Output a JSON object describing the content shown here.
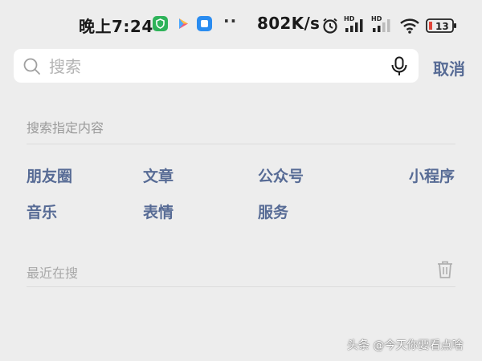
{
  "status_bar": {
    "time": "晚上7:24",
    "more_dots": "··",
    "network_speed": "802K/s",
    "signal_labels": [
      "HD",
      "HD"
    ],
    "battery": "13",
    "icons": [
      "shield-app-icon",
      "play-app-icon",
      "blue-app-icon",
      "alarm-icon",
      "signal-icon",
      "wifi-icon",
      "battery-icon"
    ]
  },
  "search": {
    "placeholder": "搜索",
    "value": "",
    "cancel_label": "取消"
  },
  "specified": {
    "title": "搜索指定内容",
    "options": [
      "朋友圈",
      "文章",
      "公众号",
      "小程序",
      "音乐",
      "表情",
      "服务"
    ]
  },
  "recent": {
    "title": "最近在搜"
  },
  "watermark": "头条 @今天你要看点啥",
  "colors": {
    "background": "#ededed",
    "link": "#576b95",
    "muted": "#9a9a9a",
    "battery_low": "#e0453a"
  }
}
